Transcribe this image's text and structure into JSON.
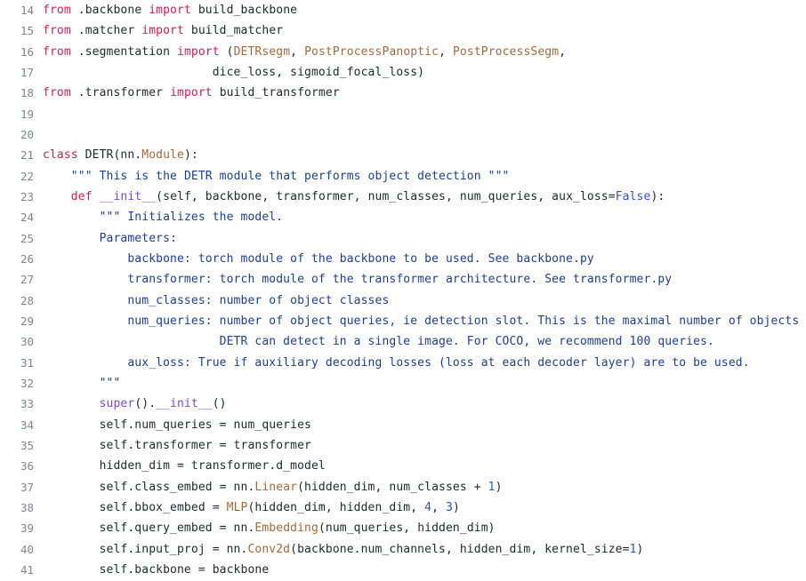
{
  "editor": {
    "language": "python",
    "background_color": "#ffffff",
    "line_number_color": "#7d8590",
    "first_line_number": 14,
    "last_line_number": 41,
    "colors": {
      "keyword": "#cc2255",
      "class_name": "#a6693b",
      "builtin": "#7b4ad1",
      "string_docstring": "#1c3f94",
      "number": "#2f55c7",
      "plain": "#24292e"
    }
  },
  "lines": [
    {
      "number": "14",
      "tokens": [
        {
          "t": "from",
          "c": "keyword"
        },
        {
          "t": " .backbone ",
          "c": "plain"
        },
        {
          "t": "import",
          "c": "keyword"
        },
        {
          "t": " build_backbone",
          "c": "plain"
        }
      ]
    },
    {
      "number": "15",
      "tokens": [
        {
          "t": "from",
          "c": "keyword"
        },
        {
          "t": " .matcher ",
          "c": "plain"
        },
        {
          "t": "import",
          "c": "keyword"
        },
        {
          "t": " build_matcher",
          "c": "plain"
        }
      ]
    },
    {
      "number": "16",
      "tokens": [
        {
          "t": "from",
          "c": "keyword"
        },
        {
          "t": " .segmentation ",
          "c": "plain"
        },
        {
          "t": "import",
          "c": "keyword"
        },
        {
          "t": " (",
          "c": "plain"
        },
        {
          "t": "DETRsegm",
          "c": "class_name"
        },
        {
          "t": ", ",
          "c": "plain"
        },
        {
          "t": "PostProcessPanoptic",
          "c": "class_name"
        },
        {
          "t": ", ",
          "c": "plain"
        },
        {
          "t": "PostProcessSegm",
          "c": "class_name"
        },
        {
          "t": ",",
          "c": "plain"
        }
      ]
    },
    {
      "number": "17",
      "tokens": [
        {
          "t": "                        dice_loss, sigmoid_focal_loss)",
          "c": "plain"
        }
      ]
    },
    {
      "number": "18",
      "tokens": [
        {
          "t": "from",
          "c": "keyword"
        },
        {
          "t": " .transformer ",
          "c": "plain"
        },
        {
          "t": "import",
          "c": "keyword"
        },
        {
          "t": " build_transformer",
          "c": "plain"
        }
      ]
    },
    {
      "number": "19",
      "tokens": [
        {
          "t": "",
          "c": "plain"
        }
      ]
    },
    {
      "number": "20",
      "tokens": [
        {
          "t": "",
          "c": "plain"
        }
      ]
    },
    {
      "number": "21",
      "tokens": [
        {
          "t": "class",
          "c": "keyword"
        },
        {
          "t": " DETR(nn.",
          "c": "plain"
        },
        {
          "t": "Module",
          "c": "class_name"
        },
        {
          "t": "):",
          "c": "plain"
        }
      ]
    },
    {
      "number": "22",
      "tokens": [
        {
          "t": "    ",
          "c": "plain"
        },
        {
          "t": "\"\"\" This is the DETR module that performs object detection \"\"\"",
          "c": "string_docstring"
        }
      ]
    },
    {
      "number": "23",
      "tokens": [
        {
          "t": "    ",
          "c": "plain"
        },
        {
          "t": "def",
          "c": "keyword"
        },
        {
          "t": " ",
          "c": "plain"
        },
        {
          "t": "__init__",
          "c": "builtin"
        },
        {
          "t": "(self, backbone, transformer, num_classes, num_queries, aux_loss=",
          "c": "plain"
        },
        {
          "t": "False",
          "c": "number"
        },
        {
          "t": "):",
          "c": "plain"
        }
      ]
    },
    {
      "number": "24",
      "tokens": [
        {
          "t": "        ",
          "c": "plain"
        },
        {
          "t": "\"\"\" Initializes the model.",
          "c": "string_docstring"
        }
      ]
    },
    {
      "number": "25",
      "tokens": [
        {
          "t": "        Parameters:",
          "c": "string_docstring"
        }
      ]
    },
    {
      "number": "26",
      "tokens": [
        {
          "t": "            backbone: torch module of the backbone to be used. See backbone.py",
          "c": "string_docstring"
        }
      ]
    },
    {
      "number": "27",
      "tokens": [
        {
          "t": "            transformer: torch module of the transformer architecture. See transformer.py",
          "c": "string_docstring"
        }
      ]
    },
    {
      "number": "28",
      "tokens": [
        {
          "t": "            num_classes: number of object classes",
          "c": "string_docstring"
        }
      ]
    },
    {
      "number": "29",
      "tokens": [
        {
          "t": "            num_queries: number of object queries, ie detection slot. This is the maximal number of objects",
          "c": "string_docstring"
        }
      ]
    },
    {
      "number": "30",
      "tokens": [
        {
          "t": "                         DETR can detect in a single image. For COCO, we recommend 100 queries.",
          "c": "string_docstring"
        }
      ]
    },
    {
      "number": "31",
      "tokens": [
        {
          "t": "            aux_loss: True if auxiliary decoding losses (loss at each decoder layer) are to be used.",
          "c": "string_docstring"
        }
      ]
    },
    {
      "number": "32",
      "tokens": [
        {
          "t": "        ",
          "c": "plain"
        },
        {
          "t": "\"\"\"",
          "c": "string_docstring"
        }
      ]
    },
    {
      "number": "33",
      "tokens": [
        {
          "t": "        ",
          "c": "plain"
        },
        {
          "t": "super",
          "c": "builtin"
        },
        {
          "t": "().",
          "c": "plain"
        },
        {
          "t": "__init__",
          "c": "builtin"
        },
        {
          "t": "()",
          "c": "plain"
        }
      ]
    },
    {
      "number": "34",
      "tokens": [
        {
          "t": "        self.num_queries = num_queries",
          "c": "plain"
        }
      ]
    },
    {
      "number": "35",
      "tokens": [
        {
          "t": "        self.transformer = transformer",
          "c": "plain"
        }
      ]
    },
    {
      "number": "36",
      "tokens": [
        {
          "t": "        hidden_dim = transformer.d_model",
          "c": "plain"
        }
      ]
    },
    {
      "number": "37",
      "tokens": [
        {
          "t": "        self.class_embed = nn.",
          "c": "plain"
        },
        {
          "t": "Linear",
          "c": "class_name"
        },
        {
          "t": "(hidden_dim, num_classes + ",
          "c": "plain"
        },
        {
          "t": "1",
          "c": "number"
        },
        {
          "t": ")",
          "c": "plain"
        }
      ]
    },
    {
      "number": "38",
      "tokens": [
        {
          "t": "        self.bbox_embed = ",
          "c": "plain"
        },
        {
          "t": "MLP",
          "c": "class_name"
        },
        {
          "t": "(hidden_dim, hidden_dim, ",
          "c": "plain"
        },
        {
          "t": "4",
          "c": "number"
        },
        {
          "t": ", ",
          "c": "plain"
        },
        {
          "t": "3",
          "c": "number"
        },
        {
          "t": ")",
          "c": "plain"
        }
      ]
    },
    {
      "number": "39",
      "tokens": [
        {
          "t": "        self.query_embed = nn.",
          "c": "plain"
        },
        {
          "t": "Embedding",
          "c": "class_name"
        },
        {
          "t": "(num_queries, hidden_dim)",
          "c": "plain"
        }
      ]
    },
    {
      "number": "40",
      "tokens": [
        {
          "t": "        self.input_proj = nn.",
          "c": "plain"
        },
        {
          "t": "Conv2d",
          "c": "class_name"
        },
        {
          "t": "(backbone.num_channels, hidden_dim, kernel_size=",
          "c": "plain"
        },
        {
          "t": "1",
          "c": "number"
        },
        {
          "t": ")",
          "c": "plain"
        }
      ]
    },
    {
      "number": "41",
      "tokens": [
        {
          "t": "        self.backbone = backbone",
          "c": "plain"
        }
      ]
    }
  ]
}
